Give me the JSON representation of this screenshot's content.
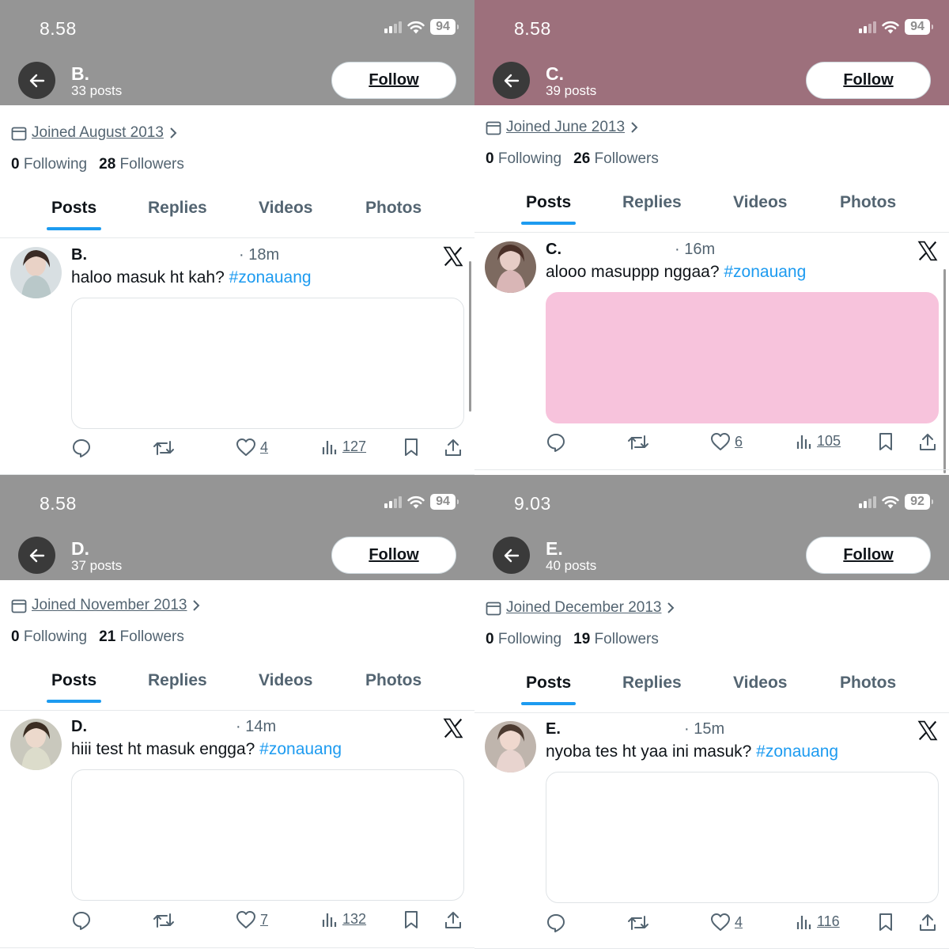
{
  "tabs_labels": [
    "Posts",
    "Replies",
    "Videos",
    "Photos"
  ],
  "follow_label": "Follow",
  "following_label": "Following",
  "followers_label": "Followers",
  "colors": {
    "hashtag": "#1d9bf0",
    "tab_indicator": "#1d9bf0",
    "header_gray": "#959595",
    "header_mauve": "#9d707c",
    "media_pink": "#f7c3dc"
  },
  "panels": [
    {
      "time": "8.58",
      "battery": "94",
      "header_color": "#959595",
      "name": "B.",
      "posts": "33 posts",
      "joined": "Joined August 2013",
      "following_count": "0",
      "followers_count": "28",
      "tweet": {
        "name": "B.",
        "time": "· 18m",
        "text": "haloo masuk ht kah?",
        "hashtag": "#zonauang",
        "likes": "4",
        "views": "127",
        "media": "white"
      }
    },
    {
      "time": "8.58",
      "battery": "94",
      "header_color": "#9d707c",
      "name": "C.",
      "posts": "39 posts",
      "joined": "Joined June 2013",
      "following_count": "0",
      "followers_count": "26",
      "tweet": {
        "name": "C.",
        "time": "· 16m",
        "text": "alooo masuppp nggaa?",
        "hashtag": "#zonauang",
        "likes": "6",
        "views": "105",
        "media": "pink"
      }
    },
    {
      "time": "8.58",
      "battery": "94",
      "header_color": "#959595",
      "name": "D.",
      "posts": "37 posts",
      "joined": "Joined November 2013",
      "following_count": "0",
      "followers_count": "21",
      "tweet": {
        "name": "D.",
        "time": "· 14m",
        "text": "hiii test ht masuk engga?",
        "hashtag": "#zonauang",
        "likes": "7",
        "views": "132",
        "media": "white"
      }
    },
    {
      "time": "9.03",
      "battery": "92",
      "header_color": "#959595",
      "name": "E.",
      "posts": "40 posts",
      "joined": "Joined December 2013",
      "following_count": "0",
      "followers_count": "19",
      "tweet": {
        "name": "E.",
        "time": "· 15m",
        "text": "nyoba tes ht yaa ini masuk?",
        "hashtag": "#zonauang",
        "likes": "4",
        "views": "116",
        "media": "white"
      }
    }
  ]
}
